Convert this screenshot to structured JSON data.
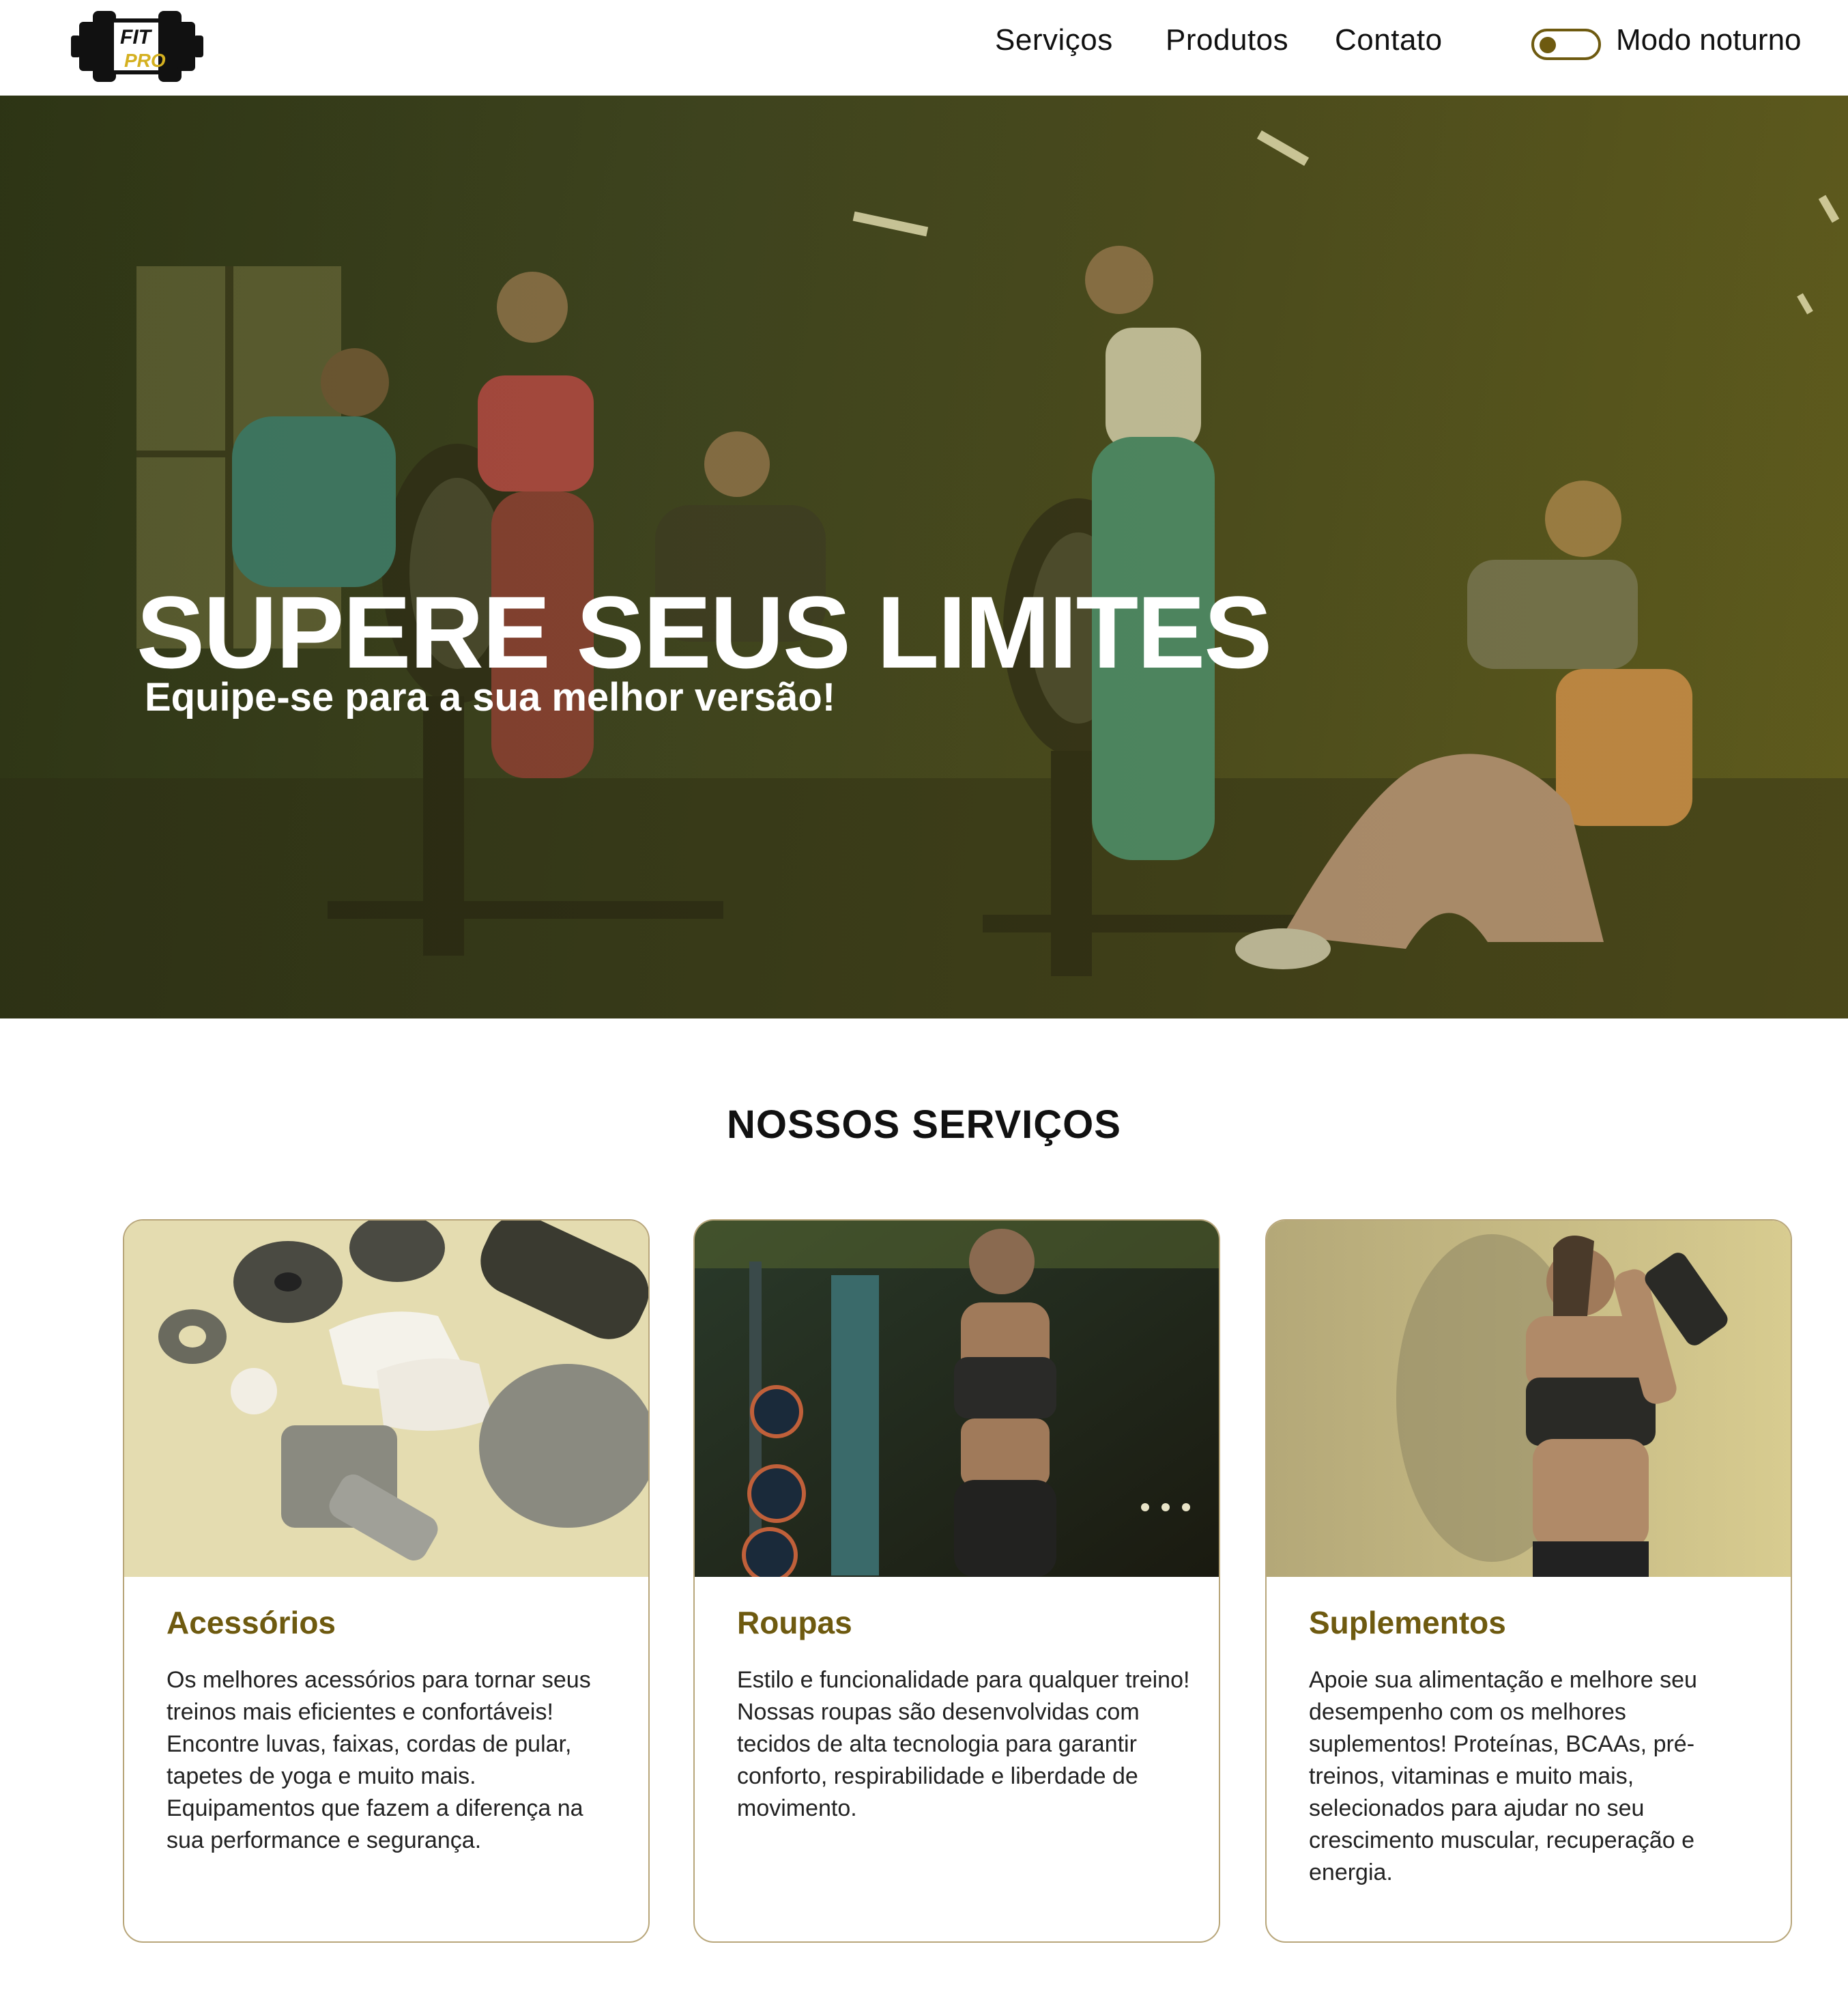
{
  "header": {
    "logo": {
      "top_text": "FIT",
      "bottom_text": "PRO"
    },
    "nav": [
      "Serviços",
      "Produtos",
      "Contato"
    ],
    "night_mode_label": "Modo noturno"
  },
  "hero": {
    "title": "SUPERE SEUS LIMITES",
    "subtitle": "Equipe-se para a sua melhor versão!"
  },
  "services": {
    "title": "NOSSOS SERVIÇOS",
    "cards": [
      {
        "title": "Acessórios",
        "text": "Os melhores acessórios para tornar seus treinos mais eficientes e confortáveis! Encontre luvas, faixas, cordas de pular, tapetes de yoga e muito mais. Equipamentos que fazem a diferença na sua performance e segurança."
      },
      {
        "title": "Roupas",
        "text": "Estilo e funcionalidade para qualquer treino! Nossas roupas são desenvolvidas com tecidos de alta tecnologia para garantir conforto, respirabilidade e liberdade de movimento."
      },
      {
        "title": "Suplementos",
        "text": "Apoie sua alimentação e melhore seu desempenho com os melhores suplementos! Proteínas, BCAAs, pré-treinos, vitaminas e muito mais, selecionados para ajudar no seu crescimento muscular, recuperação e energia."
      }
    ]
  },
  "colors": {
    "accent": "#6e5a10",
    "logo_gold": "#d4b020",
    "card_border": "#b8a67a"
  },
  "icons": [
    "dumbbell-logo-icon",
    "toggle-switch"
  ]
}
